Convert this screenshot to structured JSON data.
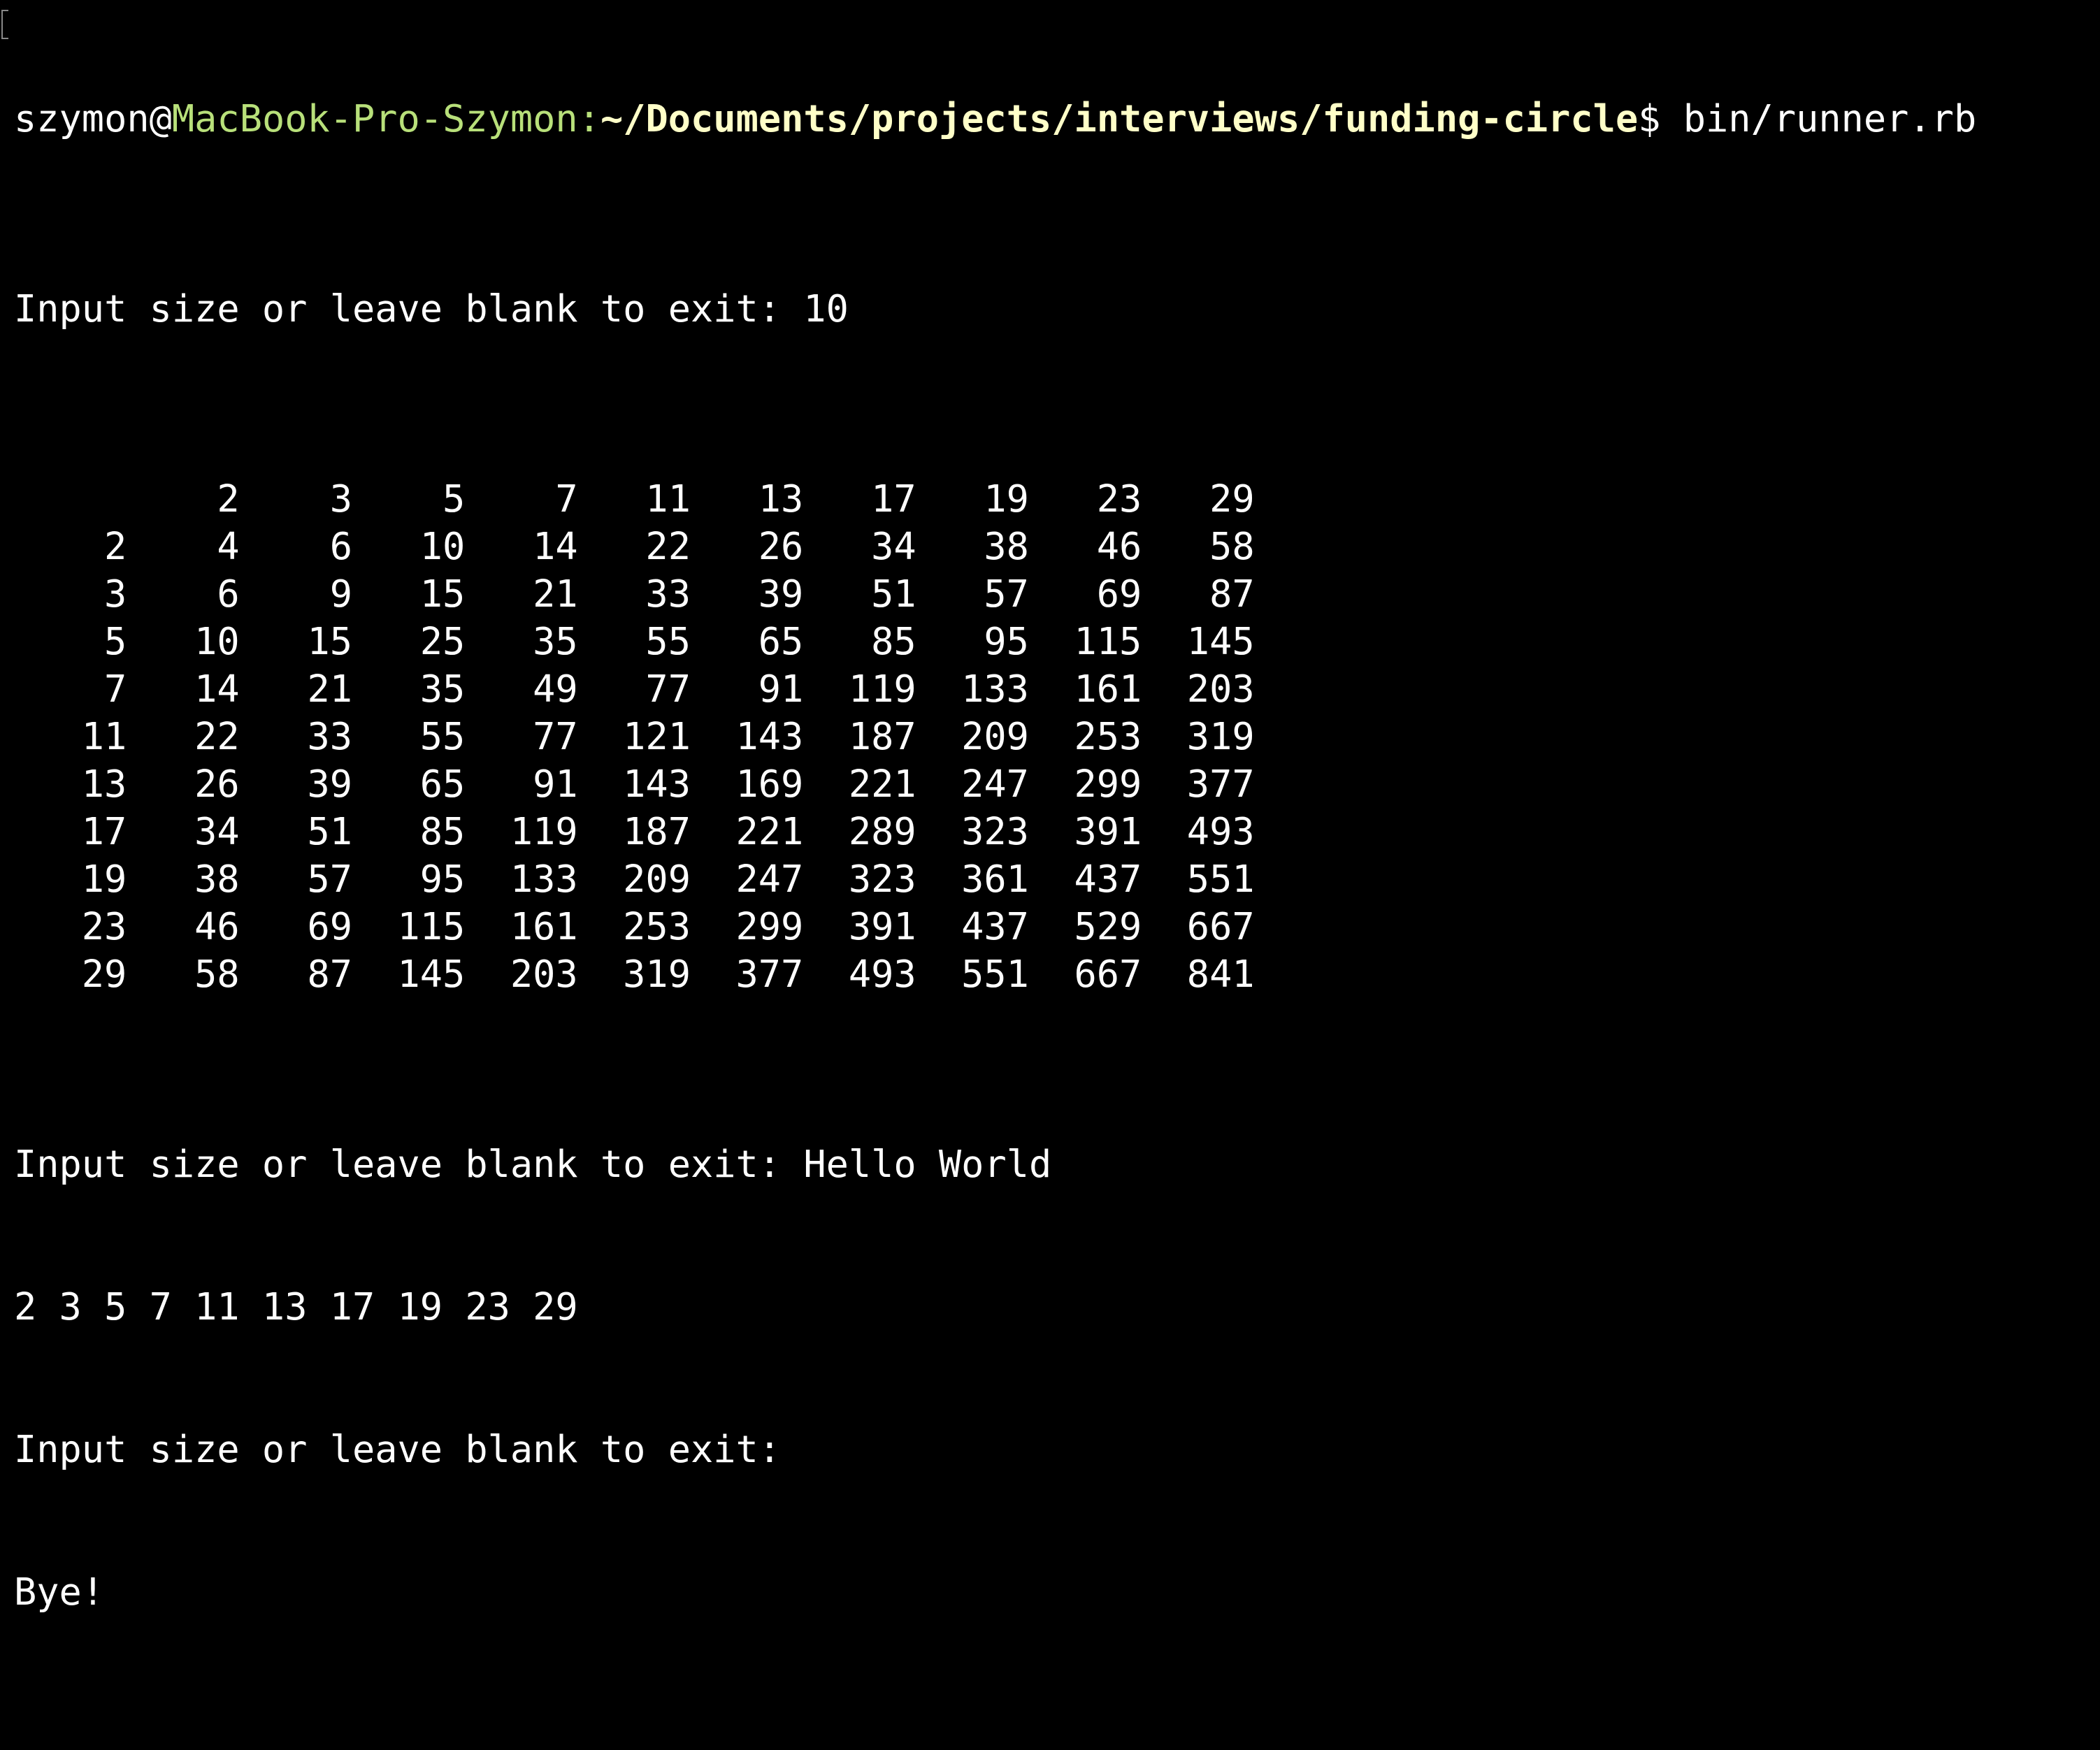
{
  "prompt": {
    "user": "szymon",
    "at": "@",
    "host": "MacBook-Pro-Szymon",
    "colon": ":",
    "path": "~/Documents/projects/interviews/funding-circle",
    "dollar": "$",
    "command": " bin/runner.rb"
  },
  "session": {
    "input_prompt_1": "Input size or leave blank to exit: 10",
    "input_prompt_2": "Input size or leave blank to exit: Hello World",
    "primes_line": "2 3 5 7 11 13 17 19 23 29",
    "input_prompt_3": "Input size or leave blank to exit:",
    "bye": "Bye!"
  },
  "table": {
    "header": [
      "",
      "2",
      "3",
      "5",
      "7",
      "11",
      "13",
      "17",
      "19",
      "23",
      "29"
    ],
    "rows": [
      [
        "2",
        "4",
        "6",
        "10",
        "14",
        "22",
        "26",
        "34",
        "38",
        "46",
        "58"
      ],
      [
        "3",
        "6",
        "9",
        "15",
        "21",
        "33",
        "39",
        "51",
        "57",
        "69",
        "87"
      ],
      [
        "5",
        "10",
        "15",
        "25",
        "35",
        "55",
        "65",
        "85",
        "95",
        "115",
        "145"
      ],
      [
        "7",
        "14",
        "21",
        "35",
        "49",
        "77",
        "91",
        "119",
        "133",
        "161",
        "203"
      ],
      [
        "11",
        "22",
        "33",
        "55",
        "77",
        "121",
        "143",
        "187",
        "209",
        "253",
        "319"
      ],
      [
        "13",
        "26",
        "39",
        "65",
        "91",
        "143",
        "169",
        "221",
        "247",
        "299",
        "377"
      ],
      [
        "17",
        "34",
        "51",
        "85",
        "119",
        "187",
        "221",
        "289",
        "323",
        "391",
        "493"
      ],
      [
        "19",
        "38",
        "57",
        "95",
        "133",
        "209",
        "247",
        "323",
        "361",
        "437",
        "551"
      ],
      [
        "23",
        "46",
        "69",
        "115",
        "161",
        "253",
        "299",
        "391",
        "437",
        "529",
        "667"
      ],
      [
        "29",
        "58",
        "87",
        "145",
        "203",
        "319",
        "377",
        "493",
        "551",
        "667",
        "841"
      ]
    ]
  },
  "colors": {
    "background": "#000000",
    "text": "#FFFFFF",
    "host": "#B8E07A",
    "path": "#FFFFC8"
  }
}
